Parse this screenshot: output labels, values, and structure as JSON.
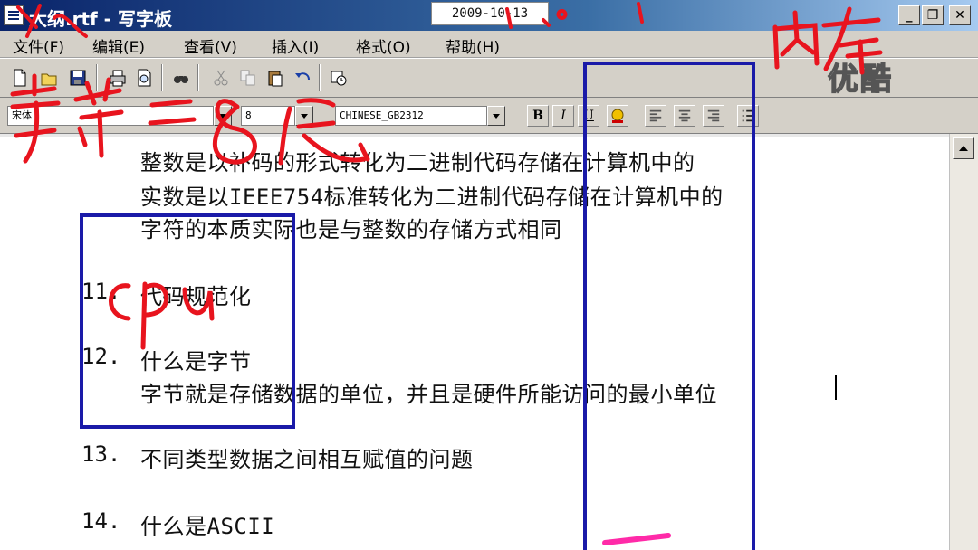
{
  "window": {
    "title": "大纲.rtf - 写字板",
    "date": "2009-10-13",
    "buttons": {
      "minimize": "_",
      "restore": "❐",
      "close": "✕"
    }
  },
  "menu": [
    "文件(F)",
    "编辑(E)",
    "查看(V)",
    "插入(I)",
    "格式(O)",
    "帮助(H)"
  ],
  "toolbar": {
    "icons": [
      "new-icon",
      "open-icon",
      "save-icon",
      "print-icon",
      "print-preview-icon",
      "find-icon",
      "cut-icon",
      "copy-icon",
      "paste-icon",
      "undo-icon",
      "insert-datetime-icon"
    ]
  },
  "format": {
    "font_name": "宋体",
    "font_size": "8",
    "script": "CHINESE_GB2312",
    "bold": "B",
    "italic": "I",
    "underline": "U"
  },
  "document": {
    "lines": [
      "整数是以补码的形式转化为二进制代码存储在计算机中的",
      "实数是以IEEE754标准转化为二进制代码存储在计算机中的",
      "字符的本质实际也是与整数的存储方式相同"
    ],
    "items": [
      {
        "num": "11.",
        "text": "代码规范化"
      },
      {
        "num": "12.",
        "text": "什么是字节"
      },
      {
        "num": "13.",
        "text": "不同类型数据之间相互赋值的问题"
      },
      {
        "num": "14.",
        "text": "什么是ASCII"
      }
    ],
    "item12_detail": "字节就是存储数据的单位，并且是硬件所能访问的最小单位"
  },
  "annotations": {
    "handwriting": [
      "字节=8位",
      "cpu",
      "内存"
    ],
    "ink_colors": {
      "red": "#e8141e",
      "blue": "#1a1aa8",
      "magenta": "#ff2aa8"
    }
  },
  "watermark": "优酷"
}
